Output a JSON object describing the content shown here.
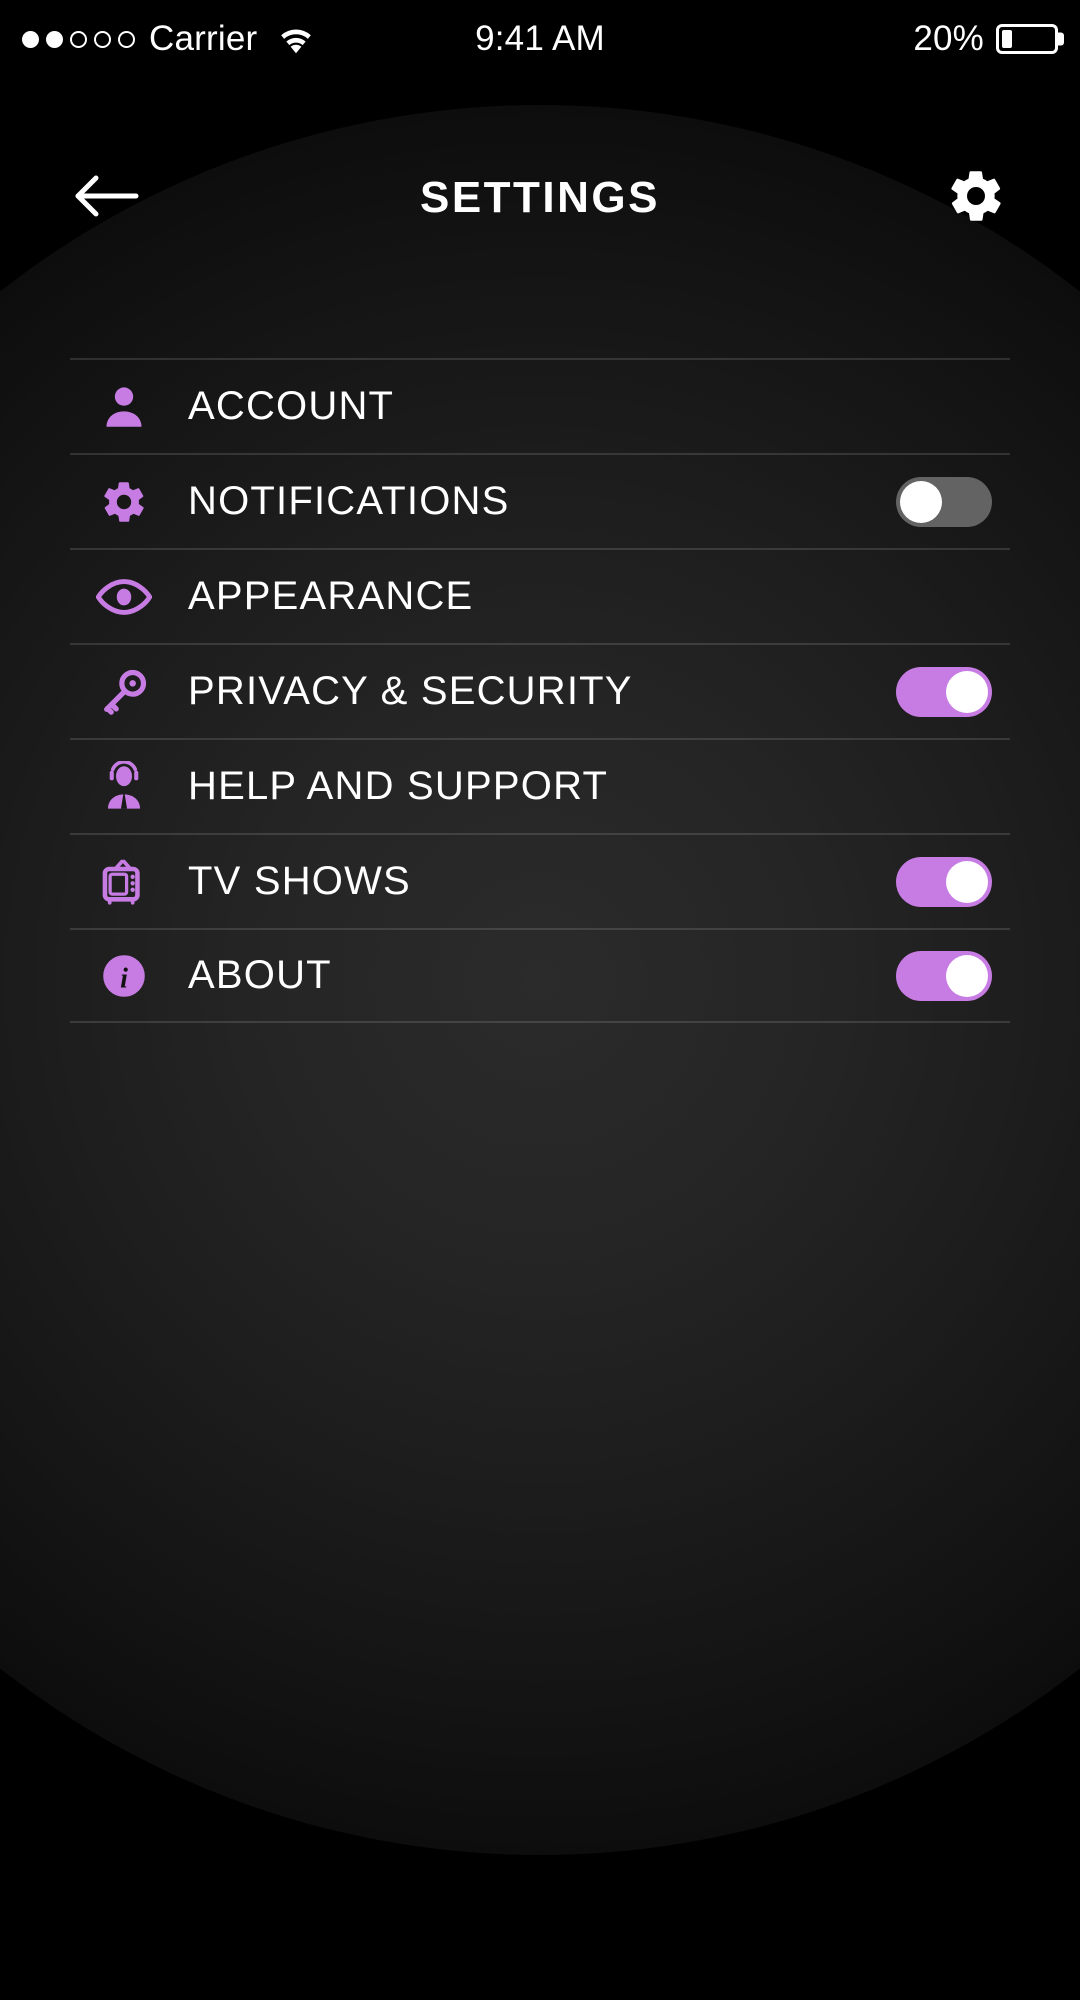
{
  "status_bar": {
    "signal_dots_total": 5,
    "signal_dots_filled": 2,
    "carrier": "Carrier",
    "wifi_icon": "wifi-icon",
    "time": "9:41 AM",
    "battery_percent": "20%",
    "battery_level": 20
  },
  "header": {
    "back_icon": "back-arrow-icon",
    "title": "SETTINGS",
    "gear_icon": "gear-icon"
  },
  "theme": {
    "background": "#000000",
    "accent": "#c77ce3",
    "text": "#ffffff",
    "toggle_off_track": "#636363",
    "divider": "rgba(255,255,255,0.13)"
  },
  "settings": {
    "items": [
      {
        "label": "ACCOUNT",
        "icon": "person-icon",
        "has_toggle": false,
        "toggle_state": null
      },
      {
        "label": "NOTIFICATIONS",
        "icon": "gear-icon",
        "has_toggle": true,
        "toggle_state": "off"
      },
      {
        "label": "APPEARANCE",
        "icon": "eye-icon",
        "has_toggle": false,
        "toggle_state": null
      },
      {
        "label": "PRIVACY & SECURITY",
        "icon": "key-icon",
        "has_toggle": true,
        "toggle_state": "on"
      },
      {
        "label": "HELP AND SUPPORT",
        "icon": "support-agent-icon",
        "has_toggle": false,
        "toggle_state": null
      },
      {
        "label": "TV SHOWS",
        "icon": "television-icon",
        "has_toggle": true,
        "toggle_state": "on"
      },
      {
        "label": "ABOUT",
        "icon": "info-circle-icon",
        "has_toggle": true,
        "toggle_state": "on"
      }
    ]
  }
}
